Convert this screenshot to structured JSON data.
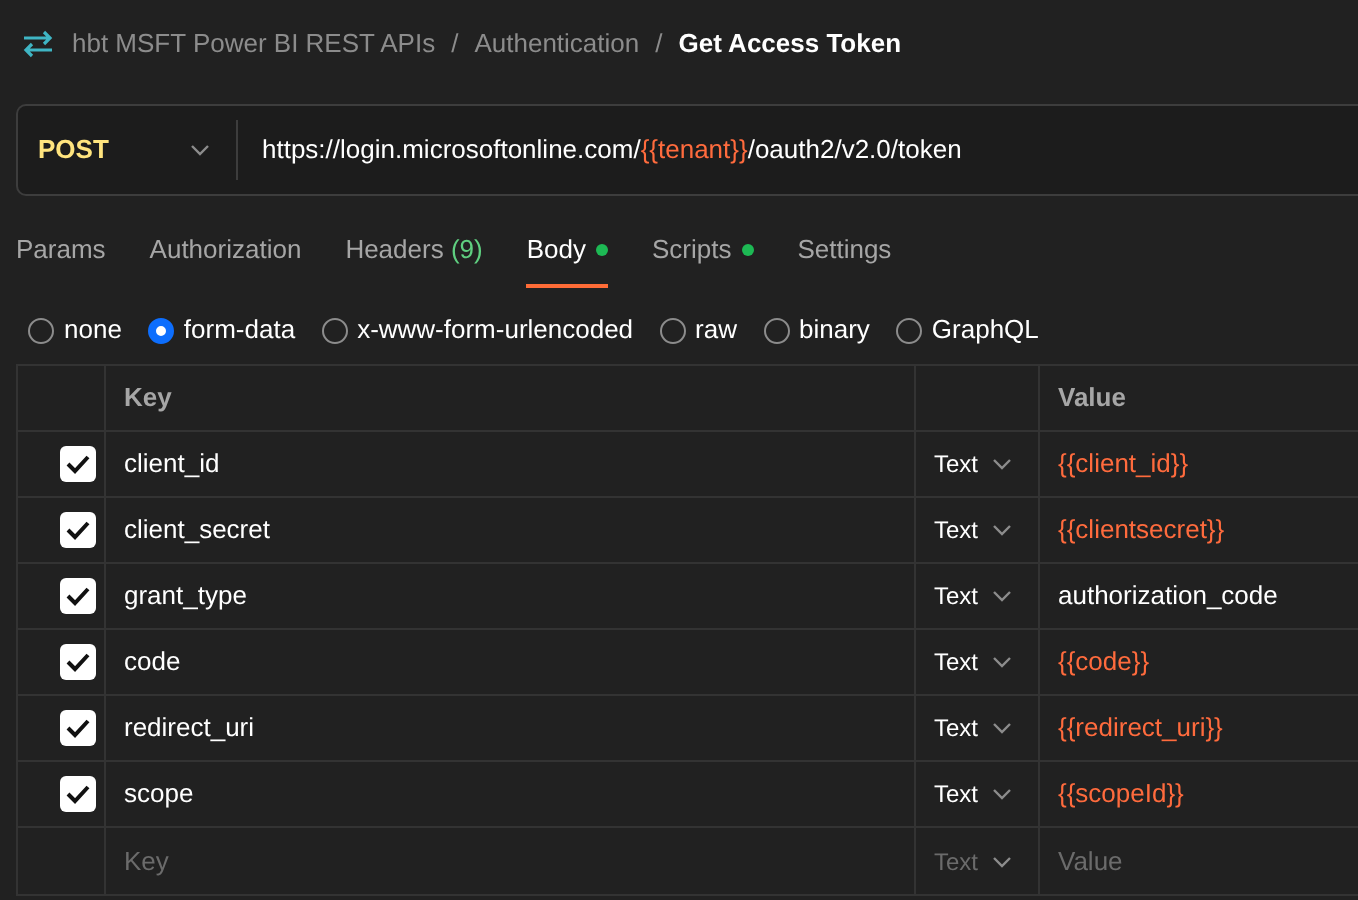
{
  "breadcrumb": [
    {
      "kind": "link",
      "text": "hbt MSFT Power BI REST APIs"
    },
    {
      "kind": "separator",
      "text": "/"
    },
    {
      "kind": "link",
      "text": "Authentication"
    },
    {
      "kind": "separator",
      "text": "/"
    },
    {
      "kind": "current",
      "text": "Get Access Token"
    }
  ],
  "request": {
    "method": "POST",
    "url": [
      {
        "kind": "text",
        "text": "https://login.microsoftonline.com/"
      },
      {
        "kind": "variable",
        "text": "{{tenant}}"
      },
      {
        "kind": "text",
        "text": "/oauth2/v2.0/token"
      }
    ]
  },
  "tabs": [
    {
      "label": "Params",
      "selected": false,
      "dot": false
    },
    {
      "label": "Authorization",
      "selected": false,
      "dot": false
    },
    {
      "label": "Headers",
      "count": "(9)",
      "selected": false,
      "dot": false
    },
    {
      "label": "Body",
      "selected": true,
      "dot": true
    },
    {
      "label": "Scripts",
      "selected": false,
      "dot": true
    },
    {
      "label": "Settings",
      "selected": false,
      "dot": false
    }
  ],
  "body_types": [
    {
      "label": "none",
      "selected": false
    },
    {
      "label": "form-data",
      "selected": true
    },
    {
      "label": "x-www-form-urlencoded",
      "selected": false
    },
    {
      "label": "raw",
      "selected": false
    },
    {
      "label": "binary",
      "selected": false
    },
    {
      "label": "GraphQL",
      "selected": false
    }
  ],
  "table": {
    "columns": [
      "Key",
      "Value"
    ],
    "rows": [
      {
        "checked": true,
        "key": "client_id",
        "type": "Text",
        "value": {
          "kind": "variable",
          "text": "{{client_id}}"
        }
      },
      {
        "checked": true,
        "key": "client_secret",
        "type": "Text",
        "value": {
          "kind": "variable",
          "text": "{{clientsecret}}"
        }
      },
      {
        "checked": true,
        "key": "grant_type",
        "type": "Text",
        "value": {
          "kind": "text",
          "text": "authorization_code"
        }
      },
      {
        "checked": true,
        "key": "code",
        "type": "Text",
        "value": {
          "kind": "variable",
          "text": "{{code}}"
        }
      },
      {
        "checked": true,
        "key": "redirect_uri",
        "type": "Text",
        "value": {
          "kind": "variable",
          "text": "{{redirect_uri}}"
        }
      },
      {
        "checked": true,
        "key": "scope",
        "type": "Text",
        "value": {
          "kind": "variable",
          "text": "{{scopeId}}"
        }
      }
    ],
    "new_row": {
      "key_placeholder": "Key",
      "type": "Text",
      "value_placeholder": "Value"
    }
  }
}
